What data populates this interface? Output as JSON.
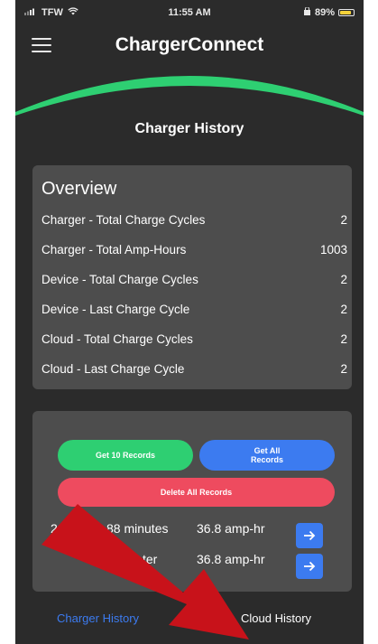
{
  "status_bar": {
    "carrier": "TFW",
    "time": "11:55 AM",
    "battery_text": "89%",
    "battery_level": 0.89
  },
  "header": {
    "app_title": "ChargerConnect"
  },
  "page": {
    "title": "Charger History"
  },
  "overview": {
    "title": "Overview",
    "rows": [
      {
        "label": "Charger - Total Charge Cycles",
        "value": "2"
      },
      {
        "label": "Charger - Total Amp-Hours",
        "value": "1003"
      },
      {
        "label": "Device - Total Charge Cycles",
        "value": "2"
      },
      {
        "label": "Device - Last Charge Cycle",
        "value": "2"
      },
      {
        "label": "Cloud - Total Charge Cycles",
        "value": "2"
      },
      {
        "label": "Cloud - Last Charge Cycle",
        "value": "2"
      }
    ]
  },
  "records": {
    "get_10_label": "Get 10 Records",
    "get_all_label": "Get All Records",
    "delete_all_label": "Delete All Records",
    "rows": [
      {
        "index": "2",
        "duration": "88 minutes",
        "amp": "36.8 amp-hr"
      },
      {
        "index": "",
        "duration": "ter",
        "amp": "36.8 amp-hr"
      }
    ]
  },
  "tabs": {
    "charger_history": "Charger History",
    "cloud_history": "Cloud History"
  },
  "colors": {
    "background": "#2b2b2b",
    "card": "#4d4d4d",
    "accent_green": "#2ecf72",
    "accent_blue": "#3c7bf0",
    "accent_red": "#ee4b5f",
    "overlay_arrow": "#c8121a"
  },
  "icons": {
    "menu": "hamburger-icon",
    "arrow": "arrow-right-icon",
    "wifi": "wifi-icon",
    "battery": "battery-icon"
  }
}
